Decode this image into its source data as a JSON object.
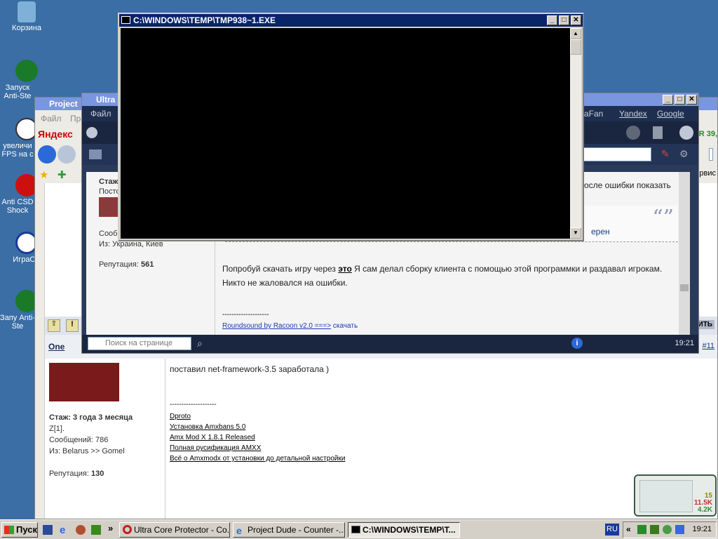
{
  "desktop": {
    "icons": [
      {
        "label": "Корзина"
      },
      {
        "label": "Запуск Anti-Ste"
      },
      {
        "label": "увеличи FPS на c"
      },
      {
        "label": "Anti CSD Shock"
      },
      {
        "label": "ИграCS"
      },
      {
        "label": "Запу Anti-Ste"
      }
    ]
  },
  "console": {
    "title": "C:\\WINDOWS\\TEMP\\TMP938~1.EXE"
  },
  "ucp": {
    "title": "Ultra",
    "menu": [
      "Файл",
      "raFan",
      "Yandex",
      "Google"
    ],
    "profile": {
      "stazh": "Стаж",
      "posts": "Посто",
      "sobsh": "Сообщ",
      "from": "Из: Украина, Киев",
      "rep_label": "Репутация:",
      "rep_value": "561"
    },
    "post_text_1": "осле ошибки показать",
    "quote_tail": "ерен",
    "post_text_2_a": "Попробуй скачать игру через ",
    "post_text_2_link": "это",
    "post_text_2_b": " Я сам делал сборку клиента с помощью этой программки и раздавал игрокам. Никто не жаловался на ошибки.",
    "signature_sep": "--------------------",
    "signature_link": "Roundsound by Racoon v2.0 ===>",
    "signature_link2": "скачать",
    "search_placeholder": "Поиск на странице",
    "time": "19:21"
  },
  "ie": {
    "title": "Project",
    "menu": [
      "Файл",
      "Пра"
    ],
    "yandex": "Яндекс",
    "right_tail": "R 39,",
    "service": "рвис",
    "post_num": "#11",
    "author": "One",
    "post_body": "поставил net-framework-3.5 заработала )",
    "sig_sep": "--------------------",
    "sig_links": [
      "Dproto",
      "Установка Amxbans 5.0",
      "Amx Mod X 1.8.1 Released",
      "Полная русификация AMXX",
      "Всё о Amxmodx от установки до детальной настройки"
    ],
    "profile": {
      "stazh": "Стаж: 3 года 3 месяца",
      "group": "Z[1].",
      "posts": "Сообщений: 786",
      "from": "Из: Belarus >> Gomel",
      "rep_label": "Репутация:",
      "rep_value": "130"
    },
    "reply_btn": "ИТЬ"
  },
  "widget": {
    "v1": "15",
    "v2": "11.5K",
    "v3": "4.2K"
  },
  "taskbar": {
    "start": "Пуск",
    "tasks": [
      "Ultra Core Protector - Co...",
      "Project Dude - Counter -...",
      "C:\\WINDOWS\\TEMP\\T..."
    ],
    "lang": "RU",
    "clock": "19:21"
  }
}
